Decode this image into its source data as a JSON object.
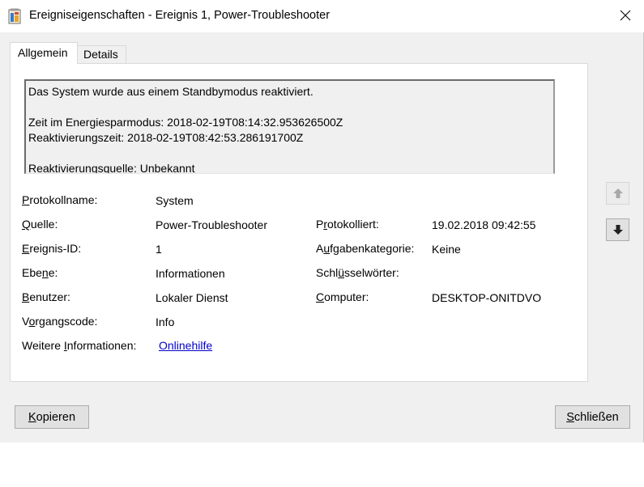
{
  "window": {
    "title": "Ereigniseigenschaften - Ereignis 1, Power-Troubleshooter"
  },
  "tabs": [
    {
      "label": "Allgemein",
      "active": true
    },
    {
      "label": "Details",
      "active": false
    }
  ],
  "description": {
    "lines": [
      "Das System wurde aus einem Standbymodus reaktiviert.",
      "",
      "Zeit im Energiesparmodus: 2018-02-19T08:14:32.953626500Z",
      "Reaktivierungszeit: 2018-02-19T08:42:53.286191700Z",
      "",
      "Reaktivierungsquelle: Unbekannt"
    ]
  },
  "fields": {
    "log_name": {
      "label": "Protokollname:",
      "value": "System",
      "access_key": "P"
    },
    "source": {
      "label": "Quelle:",
      "value": "Power-Troubleshooter",
      "access_key": "Q"
    },
    "logged": {
      "label": "Protokolliert:",
      "value": "19.02.2018 09:42:55",
      "access_key": "r"
    },
    "event_id": {
      "label": "Ereignis-ID:",
      "value": "1",
      "access_key": "E"
    },
    "task_category": {
      "label": "Aufgabenkategorie:",
      "value": "Keine",
      "access_key": "u"
    },
    "level": {
      "label": "Ebene:",
      "value": "Informationen",
      "access_key": "n"
    },
    "keywords": {
      "label": "Schlüsselwörter:",
      "value": "",
      "access_key": "ü"
    },
    "user": {
      "label": "Benutzer:",
      "value": "Lokaler Dienst",
      "access_key": "B"
    },
    "computer": {
      "label": "Computer:",
      "value": "DESKTOP-ONITDVO",
      "access_key": "C"
    },
    "opcode": {
      "label": "Vorgangscode:",
      "value": "Info",
      "access_key": "o"
    },
    "more_info": {
      "label": "Weitere Informationen:",
      "link_text": "Onlinehilfe",
      "access_key": "I"
    }
  },
  "buttons": {
    "copy": {
      "label": "Kopieren",
      "access_key": "K"
    },
    "close": {
      "label": "Schließen",
      "access_key": "S"
    }
  },
  "icons": {
    "app": "event-properties-icon",
    "close": "close-icon",
    "up": "arrow-up-icon",
    "down": "arrow-down-icon"
  },
  "colors": {
    "link": "#0000cc",
    "window_bg": "#f0f0f0",
    "panel_bg": "#ffffff"
  }
}
